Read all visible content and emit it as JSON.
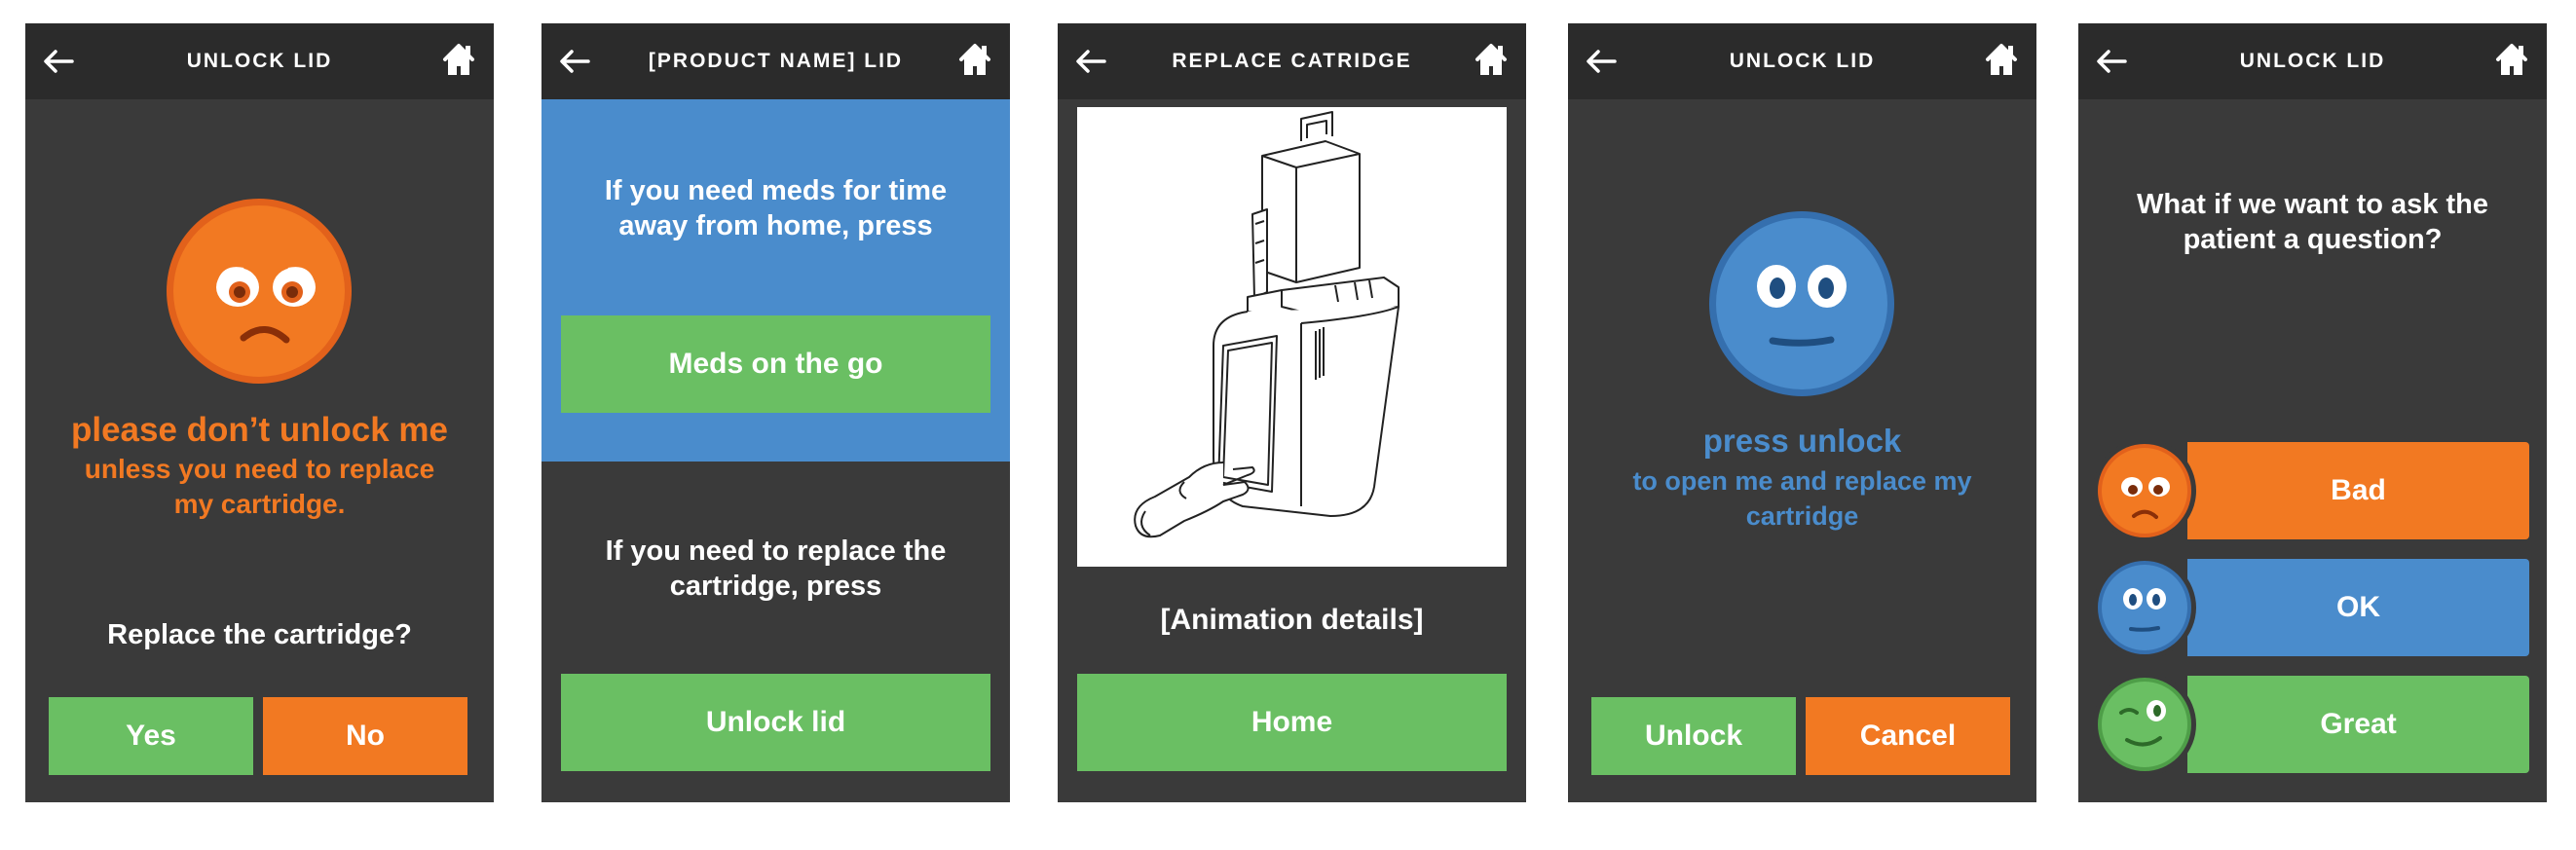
{
  "colors": {
    "screen_bg": "#3a3a3a",
    "header_bg": "#2b2b2b",
    "green": "#6abf63",
    "orange": "#f27922",
    "blue": "#4a8ccc"
  },
  "screens": [
    {
      "title": "UNLOCK LID",
      "message_main": "please don’t unlock me",
      "message_sub": "unless you need to replace my cartridge.",
      "question": "Replace the cartridge?",
      "yes_label": "Yes",
      "no_label": "No"
    },
    {
      "title": "[PRODUCT NAME] LID",
      "prompt_1": "If you need meds for time away from home, press",
      "button_1": "Meds on the go",
      "prompt_2": "If you need to replace the cartridge, press",
      "button_2": "Unlock lid"
    },
    {
      "title": "REPLACE CATRIDGE",
      "animation_caption": "[Animation details]",
      "button": "Home"
    },
    {
      "title": "UNLOCK LID",
      "message_main": "press unlock",
      "message_sub": "to open me and replace my cartridge",
      "unlock_label": "Unlock",
      "cancel_label": "Cancel"
    },
    {
      "title": "UNLOCK LID",
      "question": "What if we want to ask the patient a question?",
      "options": [
        "Bad",
        "OK",
        "Great"
      ]
    }
  ],
  "icons": [
    "back-arrow-icon",
    "home-icon",
    "sad-face-icon",
    "neutral-face-icon",
    "wink-face-icon"
  ]
}
